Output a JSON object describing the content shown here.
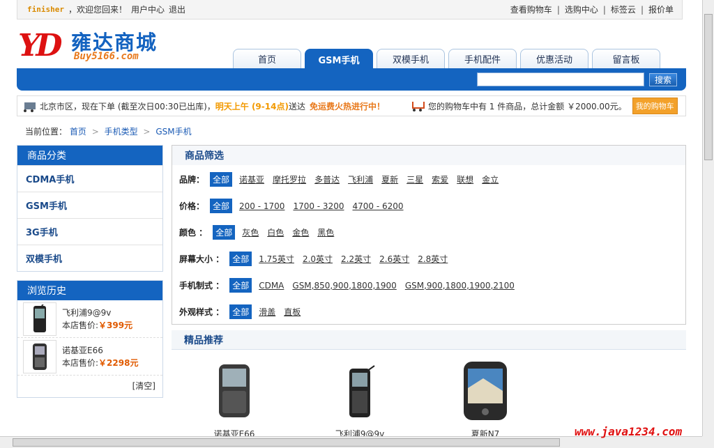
{
  "topbar": {
    "username": "finisher",
    "welcome": "，欢迎您回来！",
    "user_center": "用户中心",
    "logout": "退出",
    "links": [
      "查看购物车",
      "选购中心",
      "标签云",
      "报价单"
    ],
    "separator": "|"
  },
  "logo": {
    "mark": "YD",
    "cn": "雍达商城",
    "en": "Buy5166.com"
  },
  "tabs": [
    {
      "label": "首页",
      "active": false
    },
    {
      "label": "GSM手机",
      "active": true
    },
    {
      "label": "双模手机",
      "active": false
    },
    {
      "label": "手机配件",
      "active": false
    },
    {
      "label": "优惠活动",
      "active": false
    },
    {
      "label": "留言板",
      "active": false
    }
  ],
  "search": {
    "value": "",
    "button": "搜索"
  },
  "infobar": {
    "delivery_text": "北京市区，现在下单 (截至次日00:30已出库)，",
    "delivery_time": "明天上午 (9-14点)",
    "delivery_suffix": "送达",
    "promo": "免运费火热进行中！",
    "cart_text": "您的购物车中有 1 件商品，总计金额 ￥2000.00元。",
    "cart_button": "我的购物车"
  },
  "breadcrumb": {
    "prefix": "当前位置：",
    "items": [
      "首页",
      "手机类型",
      "GSM手机"
    ],
    "sep": ">"
  },
  "categories": {
    "title": "商品分类",
    "items": [
      "CDMA手机",
      "GSM手机",
      "3G手机",
      "双模手机"
    ]
  },
  "history": {
    "title": "浏览历史",
    "price_label": "本店售价:",
    "items": [
      {
        "name": "飞利浦9@9v",
        "price": "￥399元"
      },
      {
        "name": "诺基亚E66",
        "price": "￥2298元"
      }
    ],
    "clear": "[清空]"
  },
  "filter": {
    "title": "商品筛选",
    "all_label": "全部",
    "rows": [
      {
        "label": "品牌：",
        "options": [
          "诺基亚",
          "摩托罗拉",
          "多普达",
          "飞利浦",
          "夏新",
          "三星",
          "索爱",
          "联想",
          "金立"
        ]
      },
      {
        "label": "价格：",
        "options": [
          "200 - 1700",
          "1700 - 3200",
          "4700 - 6200"
        ]
      },
      {
        "label": "颜色 ：",
        "options": [
          "灰色",
          "白色",
          "金色",
          "黑色"
        ]
      },
      {
        "label": "屏幕大小 ：",
        "options": [
          "1.75英寸",
          "2.0英寸",
          "2.2英寸",
          "2.6英寸",
          "2.8英寸"
        ]
      },
      {
        "label": "手机制式 ：",
        "options": [
          "CDMA",
          "GSM,850,900,1800,1900",
          "GSM,900,1800,1900,2100"
        ]
      },
      {
        "label": "外观样式 ：",
        "options": [
          "滑盖",
          "直板"
        ]
      }
    ]
  },
  "recommend": {
    "title": "精品推荐",
    "items": [
      "诺基亚E66",
      "飞利浦9@9v",
      "夏新N7"
    ]
  },
  "watermark": "www.java1234.com"
}
